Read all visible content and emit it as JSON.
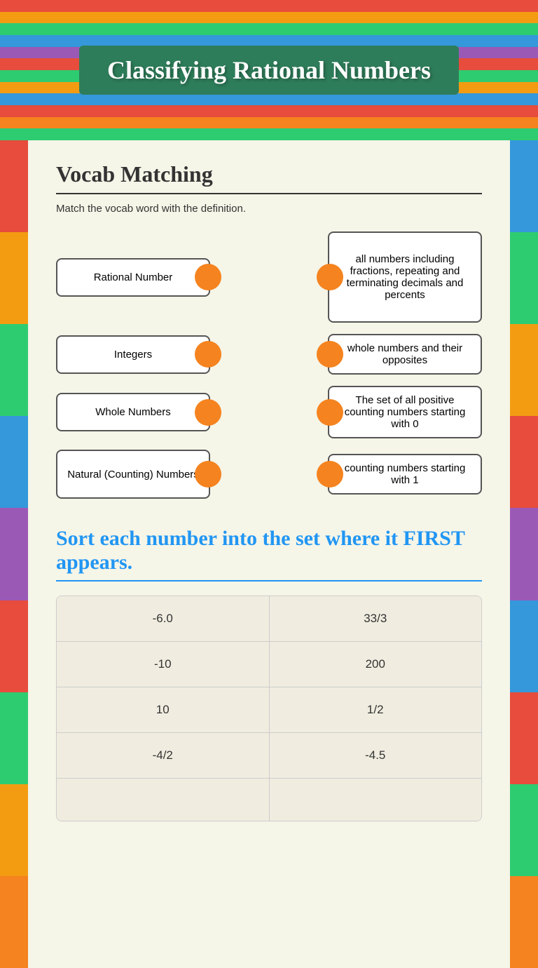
{
  "header": {
    "title": "Classifying Rational Numbers"
  },
  "stripes": {
    "colors": [
      "#e74c3c",
      "#f39c12",
      "#2ecc71",
      "#3498db",
      "#9b59b6",
      "#e74c3c",
      "#2ecc71",
      "#f39c12",
      "#3498db"
    ]
  },
  "vocab_section": {
    "title": "Vocab Matching",
    "subtitle": "Match the vocab word with the definition.",
    "terms": [
      {
        "label": "Rational Number"
      },
      {
        "label": "Integers"
      },
      {
        "label": "Whole Numbers"
      },
      {
        "label": "Natural (Counting) Numbers"
      }
    ],
    "definitions": [
      {
        "text": "all numbers including fractions, repeating and terminating decimals and percents"
      },
      {
        "text": "whole numbers and their opposites"
      },
      {
        "text": "The set of all positive counting numbers starting with 0"
      },
      {
        "text": "counting numbers starting with 1"
      }
    ]
  },
  "sort_section": {
    "title": "Sort each number into the set where it FIRST appears.",
    "rows": [
      {
        "left": "-6.0",
        "right": "33/3"
      },
      {
        "left": "-10",
        "right": "200"
      },
      {
        "left": "10",
        "right": "1/2"
      },
      {
        "left": "-4/2",
        "right": "-4.5"
      },
      {
        "left": "",
        "right": ""
      }
    ]
  }
}
